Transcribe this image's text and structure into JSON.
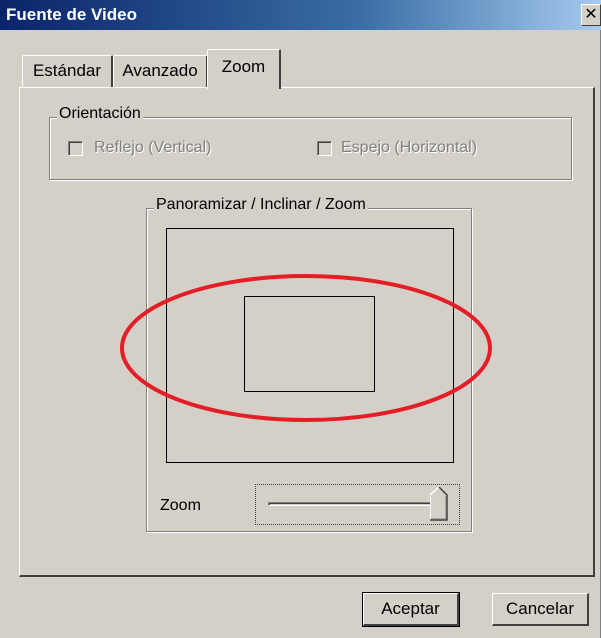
{
  "window": {
    "title": "Fuente de Video",
    "close_glyph": "✕"
  },
  "tabs": [
    {
      "label": "Estándar",
      "active": false
    },
    {
      "label": "Avanzado",
      "active": false
    },
    {
      "label": "Zoom",
      "active": true
    }
  ],
  "orientation": {
    "group_label": "Orientación",
    "reflejo": {
      "label": "Reflejo (Vertical)",
      "checked": false,
      "enabled": false
    },
    "espejo": {
      "label": "Espejo (Horizontal)",
      "checked": false,
      "enabled": false
    }
  },
  "ptz": {
    "group_label": "Panoramizar / Inclinar / Zoom",
    "zoom_label": "Zoom",
    "zoom_level": 1.0
  },
  "buttons": {
    "ok": "Aceptar",
    "cancel": "Cancelar"
  },
  "colors": {
    "face": "#d4d0c8",
    "titlebar": "#0a246a",
    "annotation": "#e41e26"
  },
  "icons": {
    "close": "close-icon",
    "slider_thumb": "slider-thumb"
  }
}
